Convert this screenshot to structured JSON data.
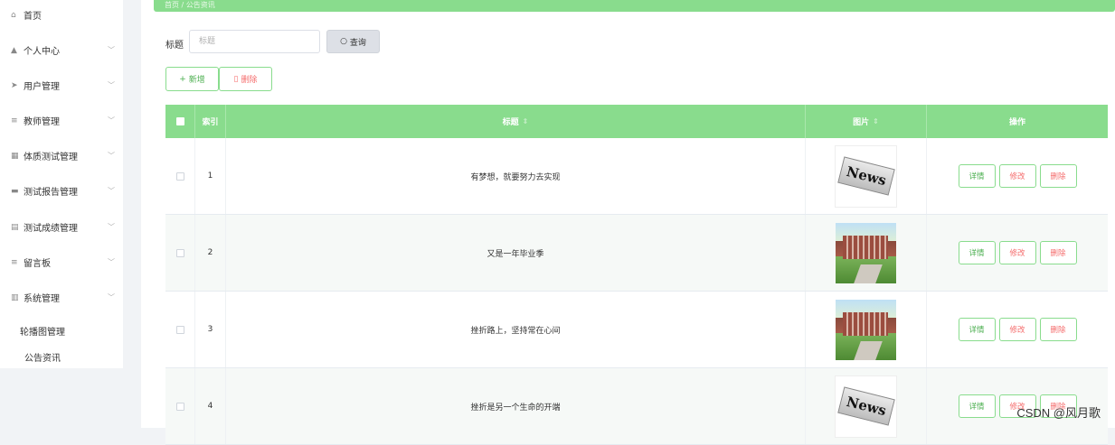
{
  "sidebar": {
    "items": [
      {
        "label": "首页",
        "icon": "home-icon",
        "glyph": "⌂",
        "expandable": false
      },
      {
        "label": "个人中心",
        "icon": "user-icon",
        "glyph": "▲",
        "expandable": true
      },
      {
        "label": "用户管理",
        "icon": "send-icon",
        "glyph": "➤",
        "expandable": true
      },
      {
        "label": "教师管理",
        "icon": "menu-icon",
        "glyph": "≡",
        "expandable": true
      },
      {
        "label": "体质测试管理",
        "icon": "grid-icon",
        "glyph": "▦",
        "expandable": true
      },
      {
        "label": "测试报告管理",
        "icon": "monitor-icon",
        "glyph": "▬",
        "expandable": true
      },
      {
        "label": "测试成绩管理",
        "icon": "document-icon",
        "glyph": "▤",
        "expandable": true
      },
      {
        "label": "留言板",
        "icon": "menu-icon",
        "glyph": "≡",
        "expandable": true
      },
      {
        "label": "系统管理",
        "icon": "chart-icon",
        "glyph": "▥",
        "expandable": true
      }
    ],
    "sub_items": [
      "轮播图管理",
      "公告资讯"
    ],
    "chevron": "﹀"
  },
  "banner": {
    "text": "首页 / 公告资讯"
  },
  "search": {
    "label": "标题",
    "placeholder": "标题",
    "button": "查询"
  },
  "toolbar": {
    "add": "新增",
    "delete": "删除"
  },
  "table": {
    "headers": {
      "index": "索引",
      "title": "标题",
      "image": "图片",
      "actions": "操作"
    },
    "rows": [
      {
        "index": "1",
        "title": "有梦想，就要努力去实现",
        "image": "news"
      },
      {
        "index": "2",
        "title": "又是一年毕业季",
        "image": "campus"
      },
      {
        "index": "3",
        "title": "挫折路上，坚持常在心间",
        "image": "campus"
      },
      {
        "index": "4",
        "title": "挫折是另一个生命的开端",
        "image": "news"
      }
    ],
    "actions": {
      "detail": "详情",
      "edit": "修改",
      "delete": "删除"
    },
    "news_image_text": "News"
  },
  "watermark": "CSDN @风月歌",
  "colors": {
    "accent": "#89dc8d",
    "danger": "#f56c6c",
    "sidebar_bg": "#ffffff"
  }
}
